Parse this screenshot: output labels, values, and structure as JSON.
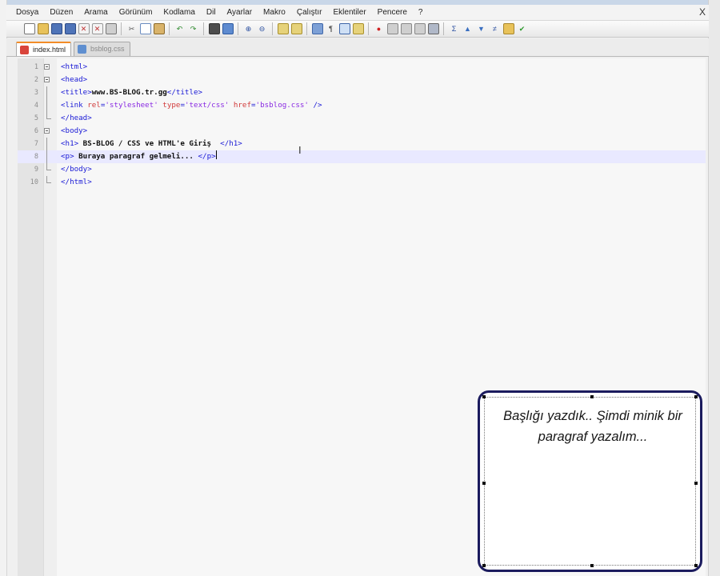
{
  "menu": {
    "items": [
      "Dosya",
      "Düzen",
      "Arama",
      "Görünüm",
      "Kodlama",
      "Dil",
      "Ayarlar",
      "Makro",
      "Çalıştır",
      "Eklentiler",
      "Pencere",
      "?"
    ],
    "close_glyph": "X"
  },
  "toolbar": {
    "groups": [
      [
        "new-file-icon",
        "open-file-icon",
        "save-icon",
        "save-all-icon",
        "close-icon",
        "close-all-icon",
        "print-icon"
      ],
      [
        "cut-icon",
        "copy-icon",
        "paste-icon"
      ],
      [
        "undo-icon",
        "redo-icon"
      ],
      [
        "find-icon",
        "replace-icon"
      ],
      [
        "zoom-in-icon",
        "zoom-out-icon"
      ],
      [
        "sync-vertical-icon",
        "sync-horizontal-icon"
      ],
      [
        "word-wrap-icon",
        "show-all-chars-icon",
        "indent-guide-icon",
        "doc-map-icon"
      ],
      [
        "record-macro-icon",
        "stop-record-icon",
        "playback-macro-icon",
        "run-macro-multiple-icon",
        "save-macro-icon"
      ],
      [
        "spell-check-icon",
        "collapse-icon",
        "expand-icon",
        "compare-icon",
        "folder-icon",
        "check-icon"
      ]
    ]
  },
  "tabs": [
    {
      "label": "index.html",
      "active": true,
      "icon": "unsaved-file-icon"
    },
    {
      "label": "bsblog.css",
      "active": false,
      "icon": "saved-file-icon"
    }
  ],
  "editor": {
    "current_line": 8,
    "lines": [
      {
        "n": "1",
        "fold": "open",
        "parts": [
          [
            "tag",
            "<html>"
          ]
        ]
      },
      {
        "n": "2",
        "fold": "open",
        "parts": [
          [
            "tag",
            "<head>"
          ]
        ]
      },
      {
        "n": "3",
        "fold": "line",
        "parts": [
          [
            "tag",
            "<title>"
          ],
          [
            "txt",
            "www.BS-BLOG.tr.gg"
          ],
          [
            "tag",
            "</title>"
          ]
        ]
      },
      {
        "n": "4",
        "fold": "line",
        "parts": [
          [
            "tag",
            "<link "
          ],
          [
            "attr",
            "rel"
          ],
          [
            "tag",
            "="
          ],
          [
            "val",
            "'stylesheet'"
          ],
          [
            "tag",
            " "
          ],
          [
            "attr",
            "type"
          ],
          [
            "tag",
            "="
          ],
          [
            "val",
            "'text/css'"
          ],
          [
            "tag",
            " "
          ],
          [
            "attr",
            "href"
          ],
          [
            "tag",
            "="
          ],
          [
            "val",
            "'bsblog.css'"
          ],
          [
            "tag",
            " />"
          ]
        ]
      },
      {
        "n": "5",
        "fold": "end",
        "parts": [
          [
            "tag",
            "</head>"
          ]
        ]
      },
      {
        "n": "6",
        "fold": "open",
        "parts": [
          [
            "tag",
            "<body>"
          ]
        ]
      },
      {
        "n": "7",
        "fold": "line",
        "parts": [
          [
            "tag",
            "<h1>"
          ],
          [
            "txt",
            " BS-BLOG / CSS ve HTML'e Giriş  "
          ],
          [
            "tag",
            "</h1>"
          ]
        ]
      },
      {
        "n": "8",
        "fold": "line",
        "parts": [
          [
            "tag",
            "<p>"
          ],
          [
            "txt",
            " Buraya paragraf gelmeli... "
          ],
          [
            "tag",
            "</p>"
          ]
        ]
      },
      {
        "n": "9",
        "fold": "end",
        "parts": [
          [
            "tag",
            "</body>"
          ]
        ]
      },
      {
        "n": "10",
        "fold": "end",
        "parts": [
          [
            "tag",
            "</html>"
          ]
        ]
      }
    ]
  },
  "callout": {
    "text": "Başlığı yazdık.. Şimdi minik bir paragraf yazalım..."
  },
  "colors": {
    "tag": "#1a1ad6",
    "attr": "#d13b3b",
    "value": "#8a2be2",
    "current_line": "#e9e9ff",
    "callout_border": "#1b1b5e"
  }
}
